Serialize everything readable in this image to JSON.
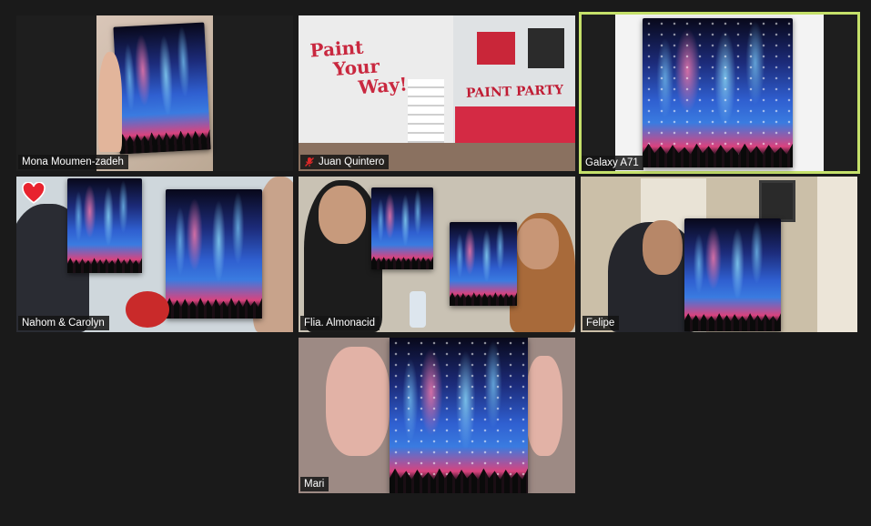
{
  "participants": [
    {
      "name": "Mona Moumen-zadeh",
      "muted": false,
      "active": false,
      "reaction": ""
    },
    {
      "name": "Juan Quintero",
      "muted": true,
      "active": false,
      "reaction": ""
    },
    {
      "name": "Galaxy A71",
      "muted": false,
      "active": true,
      "reaction": ""
    },
    {
      "name": "Nahom & Carolyn",
      "muted": false,
      "active": false,
      "reaction": "heart"
    },
    {
      "name": "Flia. Almonacid",
      "muted": false,
      "active": false,
      "reaction": ""
    },
    {
      "name": "Felipe",
      "muted": false,
      "active": false,
      "reaction": ""
    },
    {
      "name": "Mari",
      "muted": false,
      "active": false,
      "reaction": ""
    }
  ],
  "wall_sign": {
    "line1": "Paint",
    "line2": "Your",
    "line3": "Way!",
    "banner": "PAINT PARTY"
  },
  "colors": {
    "background": "#1a1a1a",
    "active_speaker": "#c5e06a",
    "mic_off": "#e02828"
  }
}
